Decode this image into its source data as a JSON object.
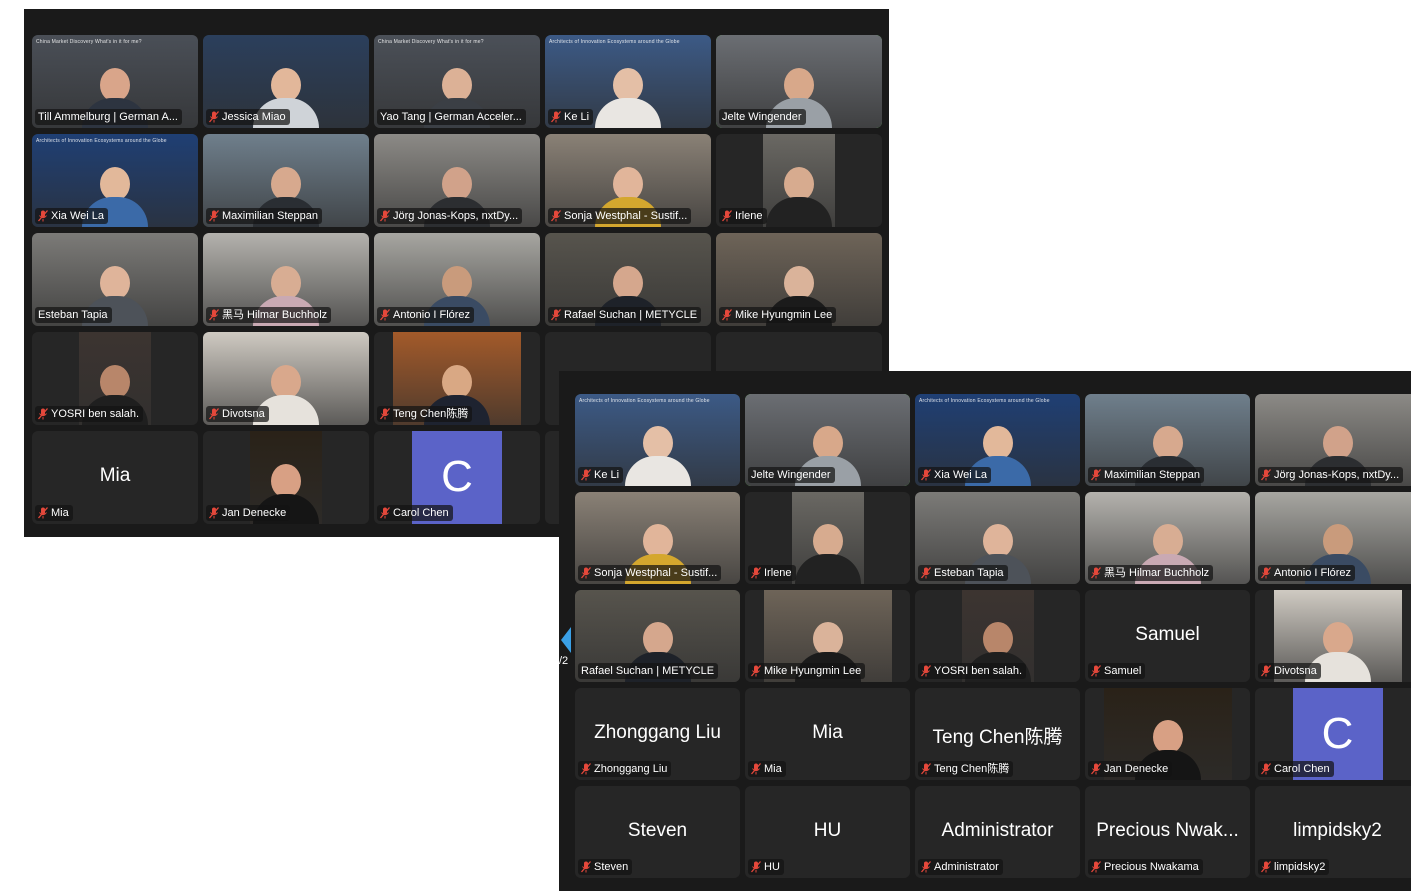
{
  "back_window": {
    "tiles": [
      {
        "name": "Till Ammelburg | German A...",
        "bg": "#4a4f57",
        "muted": false,
        "banner": "China Market Discovery   What's in it for me?",
        "skin": "#d9a58a",
        "shirt": "#2d3440"
      },
      {
        "name": "Jessica Miao",
        "bg": "#2b3f5c",
        "muted": true,
        "banner": "",
        "skin": "#e2b79a",
        "shirt": "#cfd3d8"
      },
      {
        "name": "Yao Tang | German Acceler...",
        "bg": "#4b5058",
        "muted": false,
        "banner": "China Market Discovery   What's in it for me?",
        "skin": "#dcb196",
        "shirt": "#3b3f45"
      },
      {
        "name": "Ke Li",
        "bg": "#3c5a86",
        "muted": true,
        "banner": "Architects of Innovation Ecosystems around the Globe",
        "skin": "#e4bfa6",
        "shirt": "#e9e6e2"
      },
      {
        "name": "Jelte Wingender",
        "bg": "#6b6e73",
        "muted": false,
        "active": true,
        "banner": "",
        "skin": "#d8a88a",
        "shirt": "#9aa0a6"
      },
      {
        "name": "Xia Wei La",
        "bg": "#1f3f74",
        "muted": true,
        "banner": "Architects of Innovation Ecosystems around the Globe",
        "skin": "#e2b89a",
        "shirt": "#3b6aa8"
      },
      {
        "name": "Maximilian Steppan",
        "bg": "#6f7f8c",
        "muted": true,
        "banner": "",
        "skin": "#d7a98e",
        "shirt": "#2a2e33"
      },
      {
        "name": "Jörg Jonas-Kops, nxtDy...",
        "bg": "#8c8a86",
        "muted": true,
        "banner": "",
        "skin": "#d1a28a",
        "shirt": "#2c2e31"
      },
      {
        "name": "Sonja Westphal - Sustif...",
        "bg": "#8a8176",
        "muted": true,
        "banner": "",
        "skin": "#e1b59a",
        "shirt": "#d4a72e"
      },
      {
        "name": "Irlene",
        "bg": "#6a6863",
        "muted": true,
        "narrow": true,
        "banner": "",
        "skin": "#d7ab8f",
        "shirt": "#222222"
      },
      {
        "name": "Esteban Tapia",
        "bg": "#7c7b78",
        "muted": false,
        "banner": "",
        "skin": "#dfb49a",
        "shirt": "#4d5259"
      },
      {
        "name": "黑马 Hilmar Buchholz",
        "bg": "#b4b2ad",
        "muted": true,
        "banner": "",
        "skin": "#d8ad93",
        "shirt": "#c9a9b3"
      },
      {
        "name": "Antonio I Flórez",
        "bg": "#a7a6a1",
        "muted": true,
        "banner": "",
        "skin": "#c99b7c",
        "shirt": "#3a4b63"
      },
      {
        "name": "Rafael Suchan | METYCLE",
        "bg": "#57544d",
        "muted": true,
        "banner": "",
        "skin": "#d5a78d",
        "shirt": "#1e2229"
      },
      {
        "name": "Mike Hyungmin Lee",
        "bg": "#6e6458",
        "muted": true,
        "banner": "",
        "skin": "#dab39a",
        "shirt": "#1b1b1b"
      },
      {
        "name": "YOSRI ben salah.",
        "bg": "#3c3430",
        "muted": true,
        "narrow": true,
        "banner": "",
        "skin": "#b8866a",
        "shirt": "#1f1f1f"
      },
      {
        "name": "Divotsna",
        "bg": "#cfcac2",
        "muted": true,
        "banner": "",
        "skin": "#d9a88c",
        "shirt": "#e6e2dc"
      },
      {
        "name": "Teng Chen陈腾",
        "bg": "#a35a2a",
        "muted": true,
        "med": true,
        "banner": "",
        "skin": "#d9a884",
        "shirt": "#1e2330"
      },
      {
        "name": "",
        "bg": "#262626",
        "muted": false,
        "empty": true
      },
      {
        "name": "",
        "bg": "#262626",
        "muted": false,
        "empty": true
      },
      {
        "name": "Mia",
        "big": "Mia",
        "muted": true
      },
      {
        "name": "Jan Denecke",
        "bg": "#2a2218",
        "muted": true,
        "narrow": true,
        "banner": "",
        "skin": "#d8a084",
        "shirt": "#151515"
      },
      {
        "name": "Carol Chen",
        "avatar": "C",
        "muted": true
      },
      {
        "name": "",
        "bg": "#262626",
        "muted": false,
        "empty": true
      },
      {
        "name": "",
        "bg": "#262626",
        "muted": false,
        "empty": true
      }
    ]
  },
  "front_window": {
    "page_indicator": "/2",
    "tiles": [
      {
        "name": "Ke Li",
        "bg": "#3c5a86",
        "muted": true,
        "banner": "Architects of Innovation Ecosystems around the Globe",
        "skin": "#e4bfa6",
        "shirt": "#e9e6e2"
      },
      {
        "name": "Jelte Wingender",
        "bg": "#6b6e73",
        "muted": false,
        "active": true,
        "banner": "",
        "skin": "#d8a88a",
        "shirt": "#9aa0a6"
      },
      {
        "name": "Xia Wei La",
        "bg": "#1f3f74",
        "muted": true,
        "banner": "Architects of Innovation Ecosystems around the Globe",
        "skin": "#e2b89a",
        "shirt": "#3b6aa8"
      },
      {
        "name": "Maximilian Steppan",
        "bg": "#6f7f8c",
        "muted": true,
        "banner": "",
        "skin": "#d7a98e",
        "shirt": "#2a2e33"
      },
      {
        "name": "Jörg Jonas-Kops, nxtDy...",
        "bg": "#8c8a86",
        "muted": true,
        "banner": "",
        "skin": "#d1a28a",
        "shirt": "#2c2e31"
      },
      {
        "name": "Sonja Westphal - Sustif...",
        "bg": "#8a8176",
        "muted": true,
        "banner": "",
        "skin": "#e1b59a",
        "shirt": "#d4a72e"
      },
      {
        "name": "Irlene",
        "bg": "#6a6863",
        "muted": true,
        "narrow": true,
        "banner": "",
        "skin": "#d7ab8f",
        "shirt": "#222222"
      },
      {
        "name": "Esteban Tapia",
        "bg": "#7c7b78",
        "muted": true,
        "banner": "",
        "skin": "#dfb49a",
        "shirt": "#4d5259"
      },
      {
        "name": "黑马 Hilmar Buchholz",
        "bg": "#b4b2ad",
        "muted": true,
        "banner": "",
        "skin": "#d8ad93",
        "shirt": "#c9a9b3"
      },
      {
        "name": "Antonio I Flórez",
        "bg": "#a7a6a1",
        "muted": true,
        "banner": "",
        "skin": "#c99b7c",
        "shirt": "#3a4b63"
      },
      {
        "name": "Rafael Suchan | METYCLE",
        "bg": "#57544d",
        "muted": false,
        "banner": "",
        "skin": "#d5a78d",
        "shirt": "#1e2229"
      },
      {
        "name": "Mike Hyungmin Lee",
        "bg": "#6e6458",
        "muted": true,
        "med": true,
        "banner": "",
        "skin": "#dab39a",
        "shirt": "#1b1b1b"
      },
      {
        "name": "YOSRI ben salah.",
        "bg": "#3c3430",
        "muted": true,
        "narrow": true,
        "banner": "",
        "skin": "#b8866a",
        "shirt": "#1f1f1f"
      },
      {
        "name": "Samuel",
        "big": "Samuel",
        "muted": true
      },
      {
        "name": "Divotsna",
        "bg": "#cfcac2",
        "muted": true,
        "med": true,
        "banner": "",
        "skin": "#d9a88c",
        "shirt": "#e6e2dc"
      },
      {
        "name": "Zhonggang Liu",
        "big": "Zhonggang Liu",
        "muted": true
      },
      {
        "name": "Mia",
        "big": "Mia",
        "muted": true
      },
      {
        "name": "Teng Chen陈腾",
        "big": "Teng Chen陈腾",
        "muted": true
      },
      {
        "name": "Jan Denecke",
        "bg": "#2a2218",
        "muted": true,
        "med": true,
        "banner": "",
        "skin": "#d8a084",
        "shirt": "#151515"
      },
      {
        "name": "Carol Chen",
        "avatar": "C",
        "muted": true
      },
      {
        "name": "Steven",
        "big": "Steven",
        "muted": true
      },
      {
        "name": "HU",
        "big": "HU",
        "muted": true
      },
      {
        "name": "Administrator",
        "big": "Administrator",
        "muted": true
      },
      {
        "name": "Precious Nwakama",
        "big": "Precious Nwak...",
        "muted": true
      },
      {
        "name": "limpidsky2",
        "big": "limpidsky2",
        "muted": true
      }
    ]
  },
  "colors": {
    "active_speaker": "#59d14c",
    "muted_mic": "#e5483b",
    "avatar": "#5b63c8",
    "tile": "#262626"
  }
}
